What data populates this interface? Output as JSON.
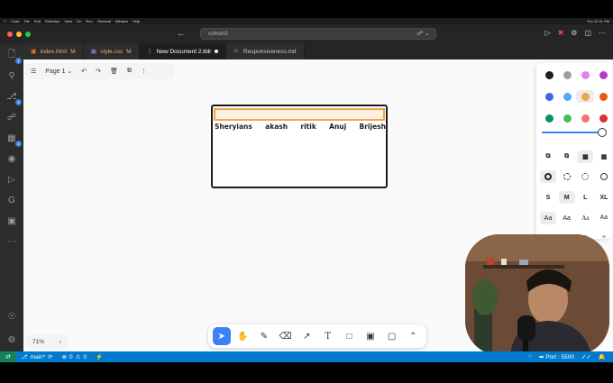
{
  "menubar": {
    "items": [
      "Code",
      "File",
      "Edit",
      "Selection",
      "View",
      "Go",
      "Run",
      "Terminal",
      "Window",
      "Help"
    ],
    "status": "Thu 12:31 PM"
  },
  "titlebar": {
    "search_text": "cohort3"
  },
  "tabs": [
    {
      "icon": "html-icon",
      "label": "index.html",
      "marker": "M",
      "color": "#e37933"
    },
    {
      "icon": "css-icon",
      "label": "style.css",
      "marker": "M",
      "color": "#a074c4"
    },
    {
      "icon": "tldraw-icon",
      "label": "New Document 2.tldr",
      "marker": "●",
      "active": true
    },
    {
      "icon": "markdown-icon",
      "label": "Responsiveness.md",
      "marker": "",
      "color": "#519aba"
    }
  ],
  "activity": {
    "explorer_badge": "1",
    "search_badge": "",
    "scm_badge": "2",
    "extensions_badge": "2"
  },
  "canvas": {
    "page_label": "Page 1",
    "zoom_label": "71%",
    "names": [
      "Sheryians",
      "akash",
      "ritik",
      "Anuj",
      "Brijesh"
    ]
  },
  "style_panel": {
    "colors": [
      {
        "hex": "#1d1d1d",
        "selected": false
      },
      {
        "hex": "#9e9e9e",
        "selected": false
      },
      {
        "hex": "#e084e8",
        "selected": false
      },
      {
        "hex": "#ae3ec9",
        "selected": false
      },
      {
        "hex": "#4263eb",
        "selected": false
      },
      {
        "hex": "#4dabf7",
        "selected": false
      },
      {
        "hex": "#f0a64a",
        "selected": true
      },
      {
        "hex": "#e8590c",
        "selected": false
      },
      {
        "hex": "#099268",
        "selected": false
      },
      {
        "hex": "#40c057",
        "selected": false
      },
      {
        "hex": "#f87171",
        "selected": false
      },
      {
        "hex": "#e03131",
        "selected": false
      }
    ],
    "opacity": 1.0,
    "sizes": [
      "S",
      "M",
      "L",
      "XL"
    ],
    "selected_size": "M",
    "fonts": [
      "Aa",
      "Aa",
      "Aa",
      "Aa"
    ]
  },
  "statusbar": {
    "branch": "main*",
    "errors": "0",
    "warnings": "0",
    "port": "Port : 5500"
  }
}
